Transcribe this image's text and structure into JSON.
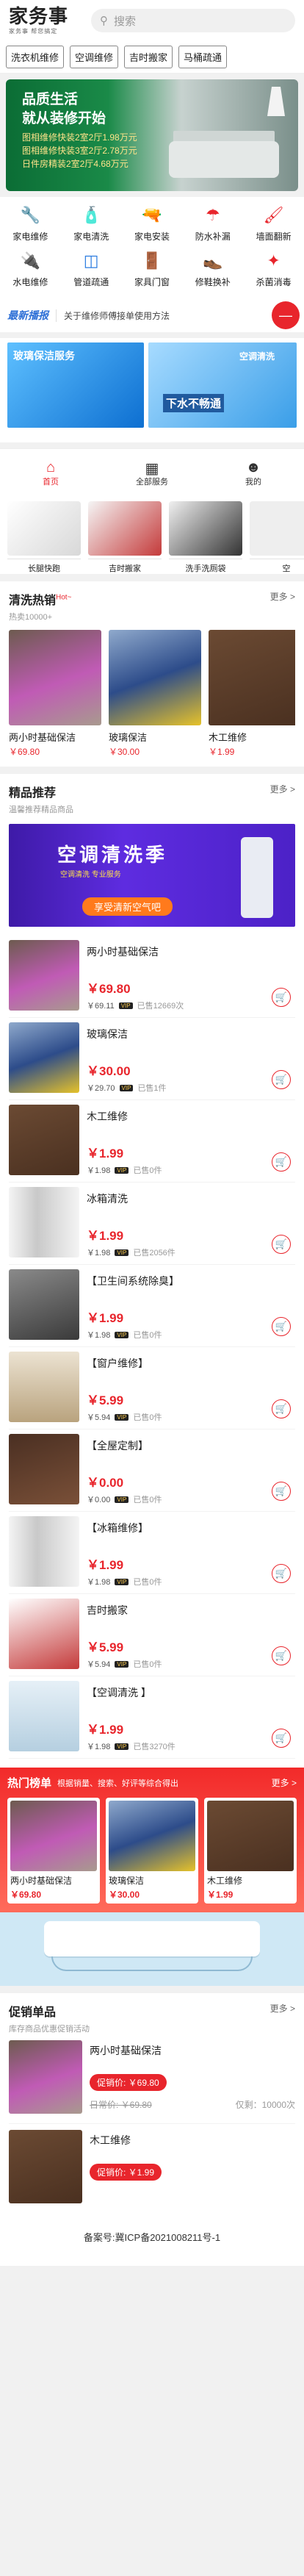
{
  "header": {
    "logo_title": "家务事",
    "logo_sub": "家务事 帮您搞定",
    "search_placeholder": "搜索"
  },
  "tags": [
    "洗衣机维修",
    "空调维修",
    "吉时搬家",
    "马桶疏通"
  ],
  "banner": {
    "line1": "品质生活",
    "line2": "就从装修开始",
    "line3": "图相维修快装2室2厅1.98万元",
    "line4": "图相维修快装3室2厅2.78万元",
    "line5": "日件房精装2室2厅4.68万元"
  },
  "categories": [
    {
      "label": "家电维修",
      "icon": "wrench-icon"
    },
    {
      "label": "家电清洗",
      "icon": "spray-icon"
    },
    {
      "label": "家电安装",
      "icon": "drill-icon"
    },
    {
      "label": "防水补漏",
      "icon": "umbrella-icon"
    },
    {
      "label": "墙面翻新",
      "icon": "paint-roller-icon"
    },
    {
      "label": "水电维修",
      "icon": "plug-icon"
    },
    {
      "label": "管道疏通",
      "icon": "pipe-icon"
    },
    {
      "label": "家具门窗",
      "icon": "door-icon"
    },
    {
      "label": "修鞋换补",
      "icon": "shoe-icon"
    },
    {
      "label": "杀菌消毒",
      "icon": "sanitize-icon"
    }
  ],
  "news": {
    "logo": "最新播报",
    "text": "关于维修师傅接单使用方法"
  },
  "promo": {
    "left": "玻璃保洁服务",
    "right_top": "空调清洗",
    "right_bottom": "下水不畅通"
  },
  "tabs": [
    {
      "label": "首页",
      "icon": "home-icon"
    },
    {
      "label": "全部服务",
      "icon": "grid-icon"
    },
    {
      "label": "我的",
      "icon": "user-icon"
    }
  ],
  "chips": [
    "长腿快跑",
    "吉时搬家",
    "洗手洗厕袋",
    "空"
  ],
  "hot": {
    "title": "清洗热销",
    "badge": "Hot~",
    "sub": "热卖10000+",
    "more": "更多 >",
    "items": [
      {
        "name": "两小时基础保洁",
        "price": "￥69.80"
      },
      {
        "name": "玻璃保洁",
        "price": "￥30.00"
      },
      {
        "name": "木工维修",
        "price": "￥1.99"
      }
    ]
  },
  "rec": {
    "title": "精品推荐",
    "sub": "温馨推荐精品商品",
    "more": "更多 >",
    "ad_title": "空调清洗季",
    "ad_sub": "空调清洗 专业服务",
    "ad_button": "享受清新空气吧"
  },
  "products": [
    {
      "name": "两小时基础保洁",
      "price": "￥69.80",
      "price2": "￥69.11",
      "sold": "已售12669次"
    },
    {
      "name": "玻璃保洁",
      "price": "￥30.00",
      "price2": "￥29.70",
      "sold": "已售1件"
    },
    {
      "name": "木工维修",
      "price": "￥1.99",
      "price2": "￥1.98",
      "sold": "已售0件"
    },
    {
      "name": "冰箱清洗",
      "price": "￥1.99",
      "price2": "￥1.98",
      "sold": "已售2056件"
    },
    {
      "name": "【卫生间系统除臭】",
      "price": "￥1.99",
      "price2": "￥1.98",
      "sold": "已售0件"
    },
    {
      "name": "【窗户维修】",
      "price": "￥5.99",
      "price2": "￥5.94",
      "sold": "已售0件"
    },
    {
      "name": "【全屋定制】",
      "price": "￥0.00",
      "price2": "￥0.00",
      "sold": "已售0件"
    },
    {
      "name": "【冰箱维修】",
      "price": "￥1.99",
      "price2": "￥1.98",
      "sold": "已售0件"
    },
    {
      "name": "吉时搬家",
      "price": "￥5.99",
      "price2": "￥5.94",
      "sold": "已售0件"
    },
    {
      "name": "【空调清洗 】",
      "price": "￥1.99",
      "price2": "￥1.98",
      "sold": "已售3270件"
    }
  ],
  "hotlist": {
    "title": "热门榜单",
    "desc": "根据销量、搜索、好评等综合得出",
    "more": "更多 >",
    "items": [
      {
        "name": "两小时基础保洁",
        "price": "￥69.80"
      },
      {
        "name": "玻璃保洁",
        "price": "￥30.00"
      },
      {
        "name": "木工维修",
        "price": "￥1.99"
      }
    ]
  },
  "sale": {
    "title": "促销单品",
    "sub": "库存商品优惠促销活动",
    "more": "更多 >",
    "items": [
      {
        "name": "两小时基础保洁",
        "badge": "促销价: ￥69.80",
        "orig": "日常价: ￥69.80",
        "remain": "仅剩：10000次"
      },
      {
        "name": "木工维修",
        "badge": "促销价: ￥1.99",
        "orig": "",
        "remain": ""
      }
    ]
  },
  "footer": "备案号:冀ICP备2021008211号-1"
}
